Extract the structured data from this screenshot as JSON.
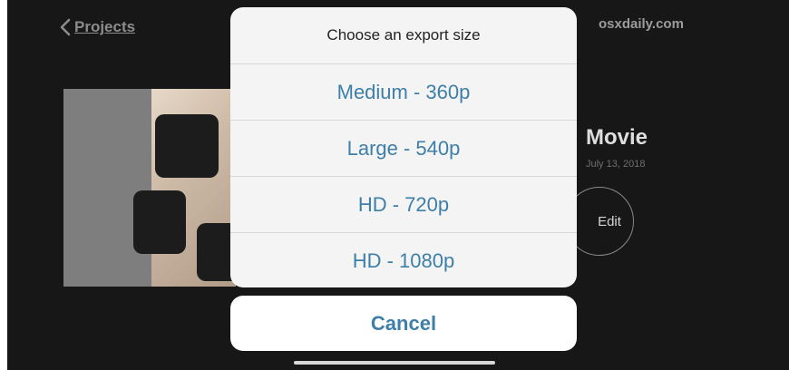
{
  "nav": {
    "back_label": "Projects",
    "site": "osxdaily.com"
  },
  "project": {
    "title": "Movie",
    "date": "July 13, 2018",
    "edit_label": "Edit"
  },
  "export_sheet": {
    "title": "Choose an export size",
    "options": [
      {
        "label": "Medium - 360p"
      },
      {
        "label": "Large - 540p"
      },
      {
        "label": "HD - 720p"
      },
      {
        "label": "HD - 1080p"
      }
    ],
    "cancel_label": "Cancel",
    "accent_color": "#3d7fa9"
  }
}
